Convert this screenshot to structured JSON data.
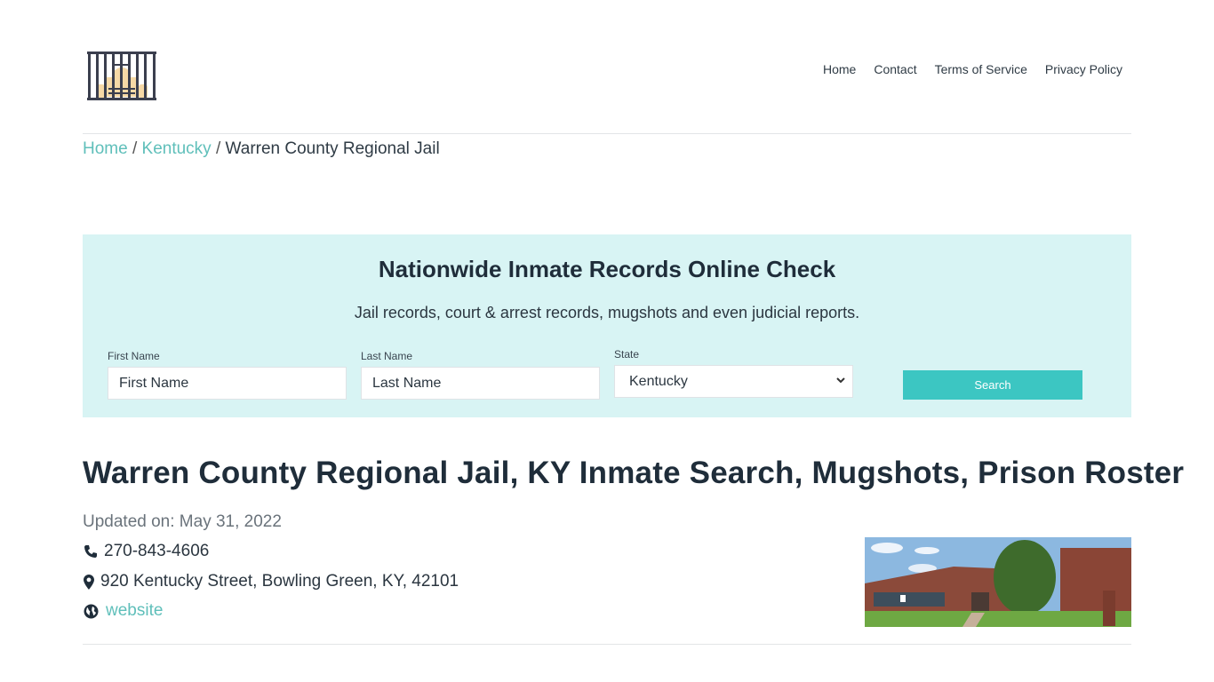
{
  "header": {
    "logo_icon": "jail-cell-icon",
    "nav": [
      {
        "label": "Home"
      },
      {
        "label": "Contact"
      },
      {
        "label": "Terms of Service"
      },
      {
        "label": "Privacy Policy"
      }
    ]
  },
  "breadcrumb": {
    "items": [
      {
        "label": "Home",
        "link": true
      },
      {
        "label": "Kentucky",
        "link": true
      },
      {
        "label": "Warren County Regional Jail",
        "link": false
      }
    ],
    "separator": "/"
  },
  "search": {
    "title": "Nationwide Inmate Records Online Check",
    "subtitle": "Jail records, court & arrest records, mugshots and even judicial reports.",
    "first_name": {
      "label": "First Name",
      "placeholder": "First Name",
      "value": ""
    },
    "last_name": {
      "label": "Last Name",
      "placeholder": "Last Name",
      "value": ""
    },
    "state": {
      "label": "State",
      "selected": "Kentucky"
    },
    "button_label": "Search"
  },
  "main": {
    "title": "Warren County Regional Jail, KY Inmate Search, Mugshots, Prison Roster",
    "updated": "Updated on: May 31, 2022",
    "phone": "270-843-4606",
    "address": "920 Kentucky Street, Bowling Green, KY, 42101",
    "website_label": "website",
    "photo_alt": "Warren County Regional Jail building"
  },
  "colors": {
    "accent": "#3cc6c2",
    "link": "#5fbfba",
    "search_bg": "#d8f4f4"
  }
}
